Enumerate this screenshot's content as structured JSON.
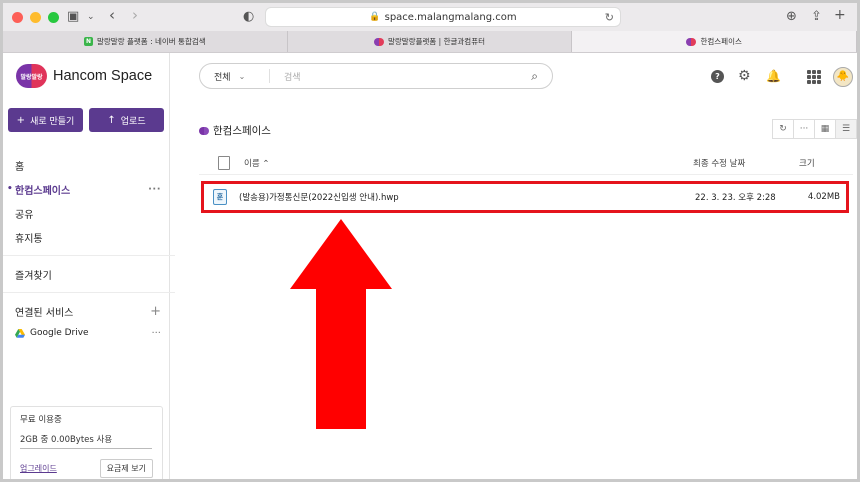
{
  "browser": {
    "url": "space.malangmalang.com",
    "tabs": [
      {
        "label": "말랑말랑 플랫폼 : 네이버 통합검색",
        "icon": "naver-favicon"
      },
      {
        "label": "말랑말랑플랫폼 | 한글과컴퓨터",
        "icon": "hancom-favicon"
      },
      {
        "label": "한컴스페이스",
        "icon": "hancom-favicon",
        "active": true
      }
    ],
    "naver_letter": "N"
  },
  "app": {
    "logo_mark_text": "말랑말랑",
    "logo_text": "Hancom Space",
    "accent_color": "#5b3a8f",
    "new_button": "새로 만들기",
    "upload_button": "업로드",
    "nav": [
      {
        "label": "홈"
      },
      {
        "label": "한컴스페이스",
        "active": true
      },
      {
        "label": "공유"
      },
      {
        "label": "휴지통"
      }
    ],
    "favorites": "즐겨찾기",
    "connected_services": "연결된 서비스",
    "google_drive": "Google Drive",
    "usage": {
      "plan": "무료 이용중",
      "amount": "2GB 중 0.00Bytes 사용",
      "upgrade": "업그레이드",
      "view_plans": "요금제 보기"
    }
  },
  "search": {
    "scope": "전체",
    "placeholder": "검색"
  },
  "avatar_icon": "🐥",
  "breadcrumb": "한컴스페이스",
  "table": {
    "col_name": "이름",
    "col_date": "최종 수정 날짜",
    "col_size": "크기",
    "rows": [
      {
        "name": "(발송용)가정통신문(2022신입생 안내).hwp",
        "date": "22. 3. 23. 오후 2:28",
        "size": "4.02MB",
        "icon": "hwp-file-icon",
        "icon_letter": "훈"
      }
    ]
  },
  "annotation": {
    "color": "#e5141c"
  }
}
